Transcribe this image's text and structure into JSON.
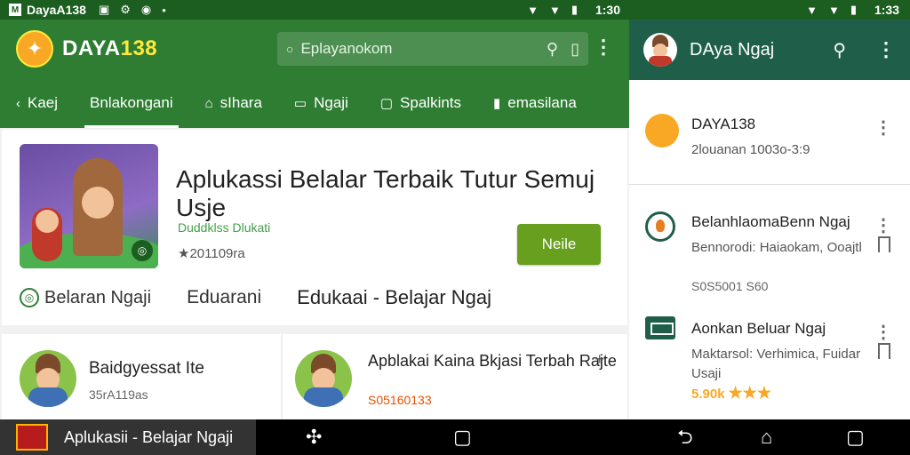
{
  "status": {
    "left": {
      "carrier": "DayaA138",
      "time": "1:30"
    },
    "right": {
      "time": "1:33"
    }
  },
  "appbar": {
    "brand_text": "DAYA",
    "brand_num": "138",
    "search_placeholder": "Eplayanokom"
  },
  "tabs": [
    {
      "label": "Kaej",
      "icon": "back-icon"
    },
    {
      "label": "Bnlakongani",
      "icon": ""
    },
    {
      "label": "sIhara",
      "icon": "home-icon"
    },
    {
      "label": "Ngaji",
      "icon": "book-icon"
    },
    {
      "label": "Spalkints",
      "icon": "window-icon"
    },
    {
      "label": "emasilana",
      "icon": "doc-icon"
    }
  ],
  "hero": {
    "title": "Aplukassi Belalar Terbaik Tutur Semuj Usje",
    "subtitle": "Duddklss Dlukati",
    "meta": "★201109ra",
    "install_label": "Neile",
    "chips": [
      "Belaran Ngaji",
      "Eduarani",
      "Edukaai - Belajar Ngaj"
    ]
  },
  "cards": [
    {
      "title": "Baidgyessat Ite",
      "meta": "35rA119as"
    },
    {
      "title": "Apblakai Kaina Bkjasi Terbah Rajte",
      "meta": "S05160133"
    }
  ],
  "right_panel": {
    "title": "DAya Ngaj",
    "items": [
      {
        "title": "DAYA138",
        "sub": "2louanan 1003o-3:9"
      },
      {
        "title": "BelanhlaomaBenn Ngaj",
        "sub": "Bennorodi: Haiaokam, Ooajtl",
        "extra": "S0S5001 S60"
      },
      {
        "title": "Aonkan Beluar Ngaj",
        "sub": "Maktarsol: Verhimica, Fuidar Usaji",
        "rating": "5.90k",
        "stars": "★★★"
      }
    ]
  },
  "navbar": {
    "app_title": "Aplukasii - Belajar Ngaji"
  }
}
